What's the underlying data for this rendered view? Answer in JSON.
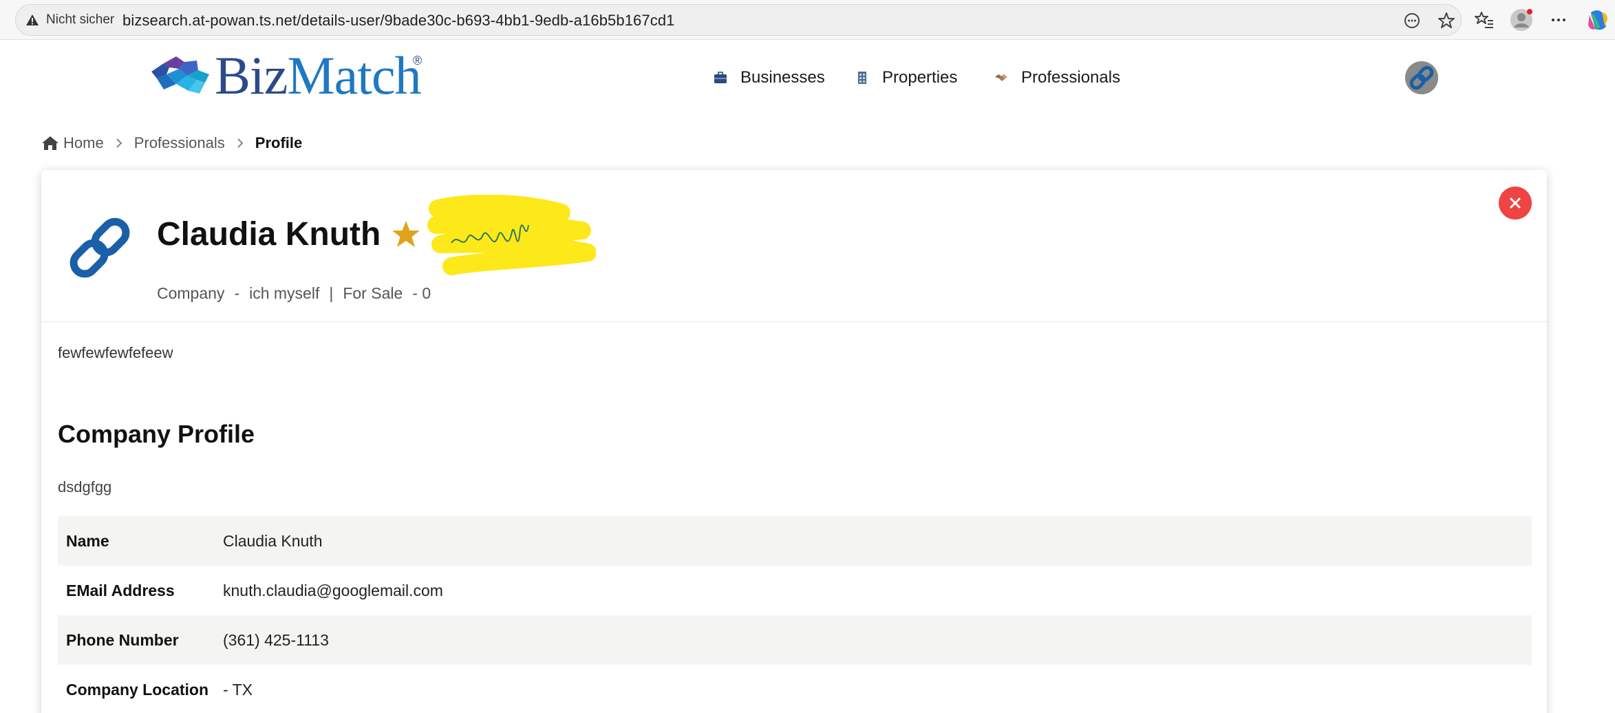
{
  "browser": {
    "security_label": "Nicht sicher",
    "url": "bizsearch.at-powan.ts.net/details-user/9bade30c-b693-4bb1-9edb-a16b5b167cd1",
    "toolbar_icons": [
      "reader-mode-icon",
      "favorite-star-icon",
      "favorites-list-icon",
      "profile-icon",
      "more-menu-icon",
      "copilot-icon"
    ],
    "colors": {
      "bar": "#f7f7f7",
      "pill": "#efefef"
    }
  },
  "header": {
    "logo_text_a": "Biz",
    "logo_text_b": "Match",
    "logo_reg": "®",
    "nav": [
      {
        "label": "Businesses",
        "icon": "briefcase-icon"
      },
      {
        "label": "Properties",
        "icon": "building-icon"
      },
      {
        "label": "Professionals",
        "icon": "handshake-icon"
      }
    ],
    "avatar_icon": "chain-link-icon"
  },
  "breadcrumb": {
    "home": "Home",
    "middle": "Professionals",
    "current": "Profile"
  },
  "profile": {
    "name": "Claudia Knuth",
    "badge_icon": "star-icon",
    "meta": {
      "company_label": "Company",
      "dash1": "-",
      "company_value": "ich myself",
      "divider": "|",
      "for_sale_label": "For Sale",
      "for_sale_value": "- 0"
    },
    "description": "fewfewfewfefeew",
    "section_title": "Company Profile",
    "section_text": "dsdgfgg",
    "details": [
      {
        "key": "Name",
        "value": "Claudia Knuth"
      },
      {
        "key": "EMail Address",
        "value": "knuth.claudia@googlemail.com"
      },
      {
        "key": "Phone Number",
        "value": "(361) 425-1113"
      },
      {
        "key": "Company Location",
        "value": "- TX"
      }
    ],
    "colors": {
      "close": "#ef4444",
      "star": "#e0a21b",
      "chain": "#1a5fa8",
      "row_shade": "#f4f4f2"
    }
  }
}
